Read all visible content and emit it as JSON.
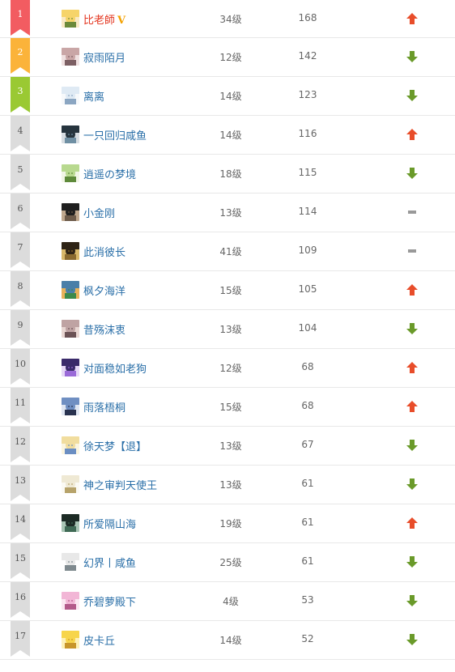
{
  "colors": {
    "rank1": "#f25c61",
    "rank2": "#fbb33a",
    "rank3": "#9ac933",
    "rank_other": "#dcdcdc",
    "name": "#2a6fa8",
    "name_top": "#e3341e",
    "vip": "#f3a100",
    "trend_up": "#e84d2a",
    "trend_down": "#6a9a2a",
    "trend_same": "#999999"
  },
  "rows": [
    {
      "rank": "1",
      "name": "比老師",
      "vip": "V",
      "level": "34级",
      "score": "168",
      "trend": "up",
      "avatar": "avatar-yellow-hair"
    },
    {
      "rank": "2",
      "name": "寂雨陌月",
      "level": "12级",
      "score": "142",
      "trend": "down",
      "avatar": "avatar-pink-figure"
    },
    {
      "rank": "3",
      "name": "离离",
      "level": "14级",
      "score": "123",
      "trend": "down",
      "avatar": "avatar-white-figure"
    },
    {
      "rank": "4",
      "name": "一只回归咸鱼",
      "level": "14级",
      "score": "116",
      "trend": "up",
      "avatar": "avatar-dark-scene"
    },
    {
      "rank": "5",
      "name": "逍遥の梦境",
      "level": "18级",
      "score": "115",
      "trend": "down",
      "avatar": "avatar-green-figure"
    },
    {
      "rank": "6",
      "name": "小金刚",
      "level": "13级",
      "score": "114",
      "trend": "same",
      "avatar": "avatar-dark-figure"
    },
    {
      "rank": "7",
      "name": "此消彼长",
      "level": "41级",
      "score": "109",
      "trend": "same",
      "avatar": "avatar-dark-glow"
    },
    {
      "rank": "8",
      "name": "枫夕海洋",
      "level": "15级",
      "score": "105",
      "trend": "up",
      "avatar": "avatar-landscape"
    },
    {
      "rank": "9",
      "name": "昔殇沫衷",
      "level": "13级",
      "score": "104",
      "trend": "down",
      "avatar": "avatar-portrait"
    },
    {
      "rank": "10",
      "name": "对面稳如老狗",
      "level": "12级",
      "score": "68",
      "trend": "up",
      "avatar": "avatar-purple"
    },
    {
      "rank": "11",
      "name": "雨落梧桐",
      "level": "15级",
      "score": "68",
      "trend": "up",
      "avatar": "avatar-blue-figure"
    },
    {
      "rank": "12",
      "name": "徐天梦【退】",
      "level": "13级",
      "score": "67",
      "trend": "down",
      "avatar": "avatar-blonde-figure"
    },
    {
      "rank": "13",
      "name": "神之审判天使王",
      "level": "13级",
      "score": "61",
      "trend": "down",
      "avatar": "avatar-light-figure"
    },
    {
      "rank": "14",
      "name": "所爱隔山海",
      "level": "19级",
      "score": "61",
      "trend": "up",
      "avatar": "avatar-dark-green"
    },
    {
      "rank": "15",
      "name": "幻界丨咸鱼",
      "level": "25级",
      "score": "61",
      "trend": "down",
      "avatar": "avatar-sketch"
    },
    {
      "rank": "16",
      "name": "乔碧萝殿下",
      "level": "4级",
      "score": "53",
      "trend": "down",
      "avatar": "avatar-pink-anime"
    },
    {
      "rank": "17",
      "name": "皮卡丘",
      "level": "14级",
      "score": "52",
      "trend": "down",
      "avatar": "avatar-pikachu"
    }
  ]
}
